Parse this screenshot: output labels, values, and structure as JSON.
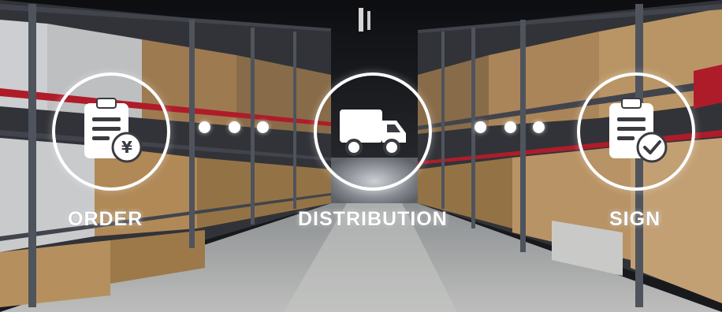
{
  "steps": [
    {
      "label": "ORDER",
      "icon": "order-clipboard-yen-icon"
    },
    {
      "label": "DISTRIBUTION",
      "icon": "delivery-truck-icon"
    },
    {
      "label": "SIGN",
      "icon": "sign-clipboard-check-icon"
    }
  ],
  "order_symbol": "¥",
  "colors": {
    "accent": "#ffffff",
    "shelf_frame": "#4a4e57",
    "shelf_beam": "#c62030",
    "cardboard": "#c49a66",
    "floor": "#c8c9c8"
  }
}
